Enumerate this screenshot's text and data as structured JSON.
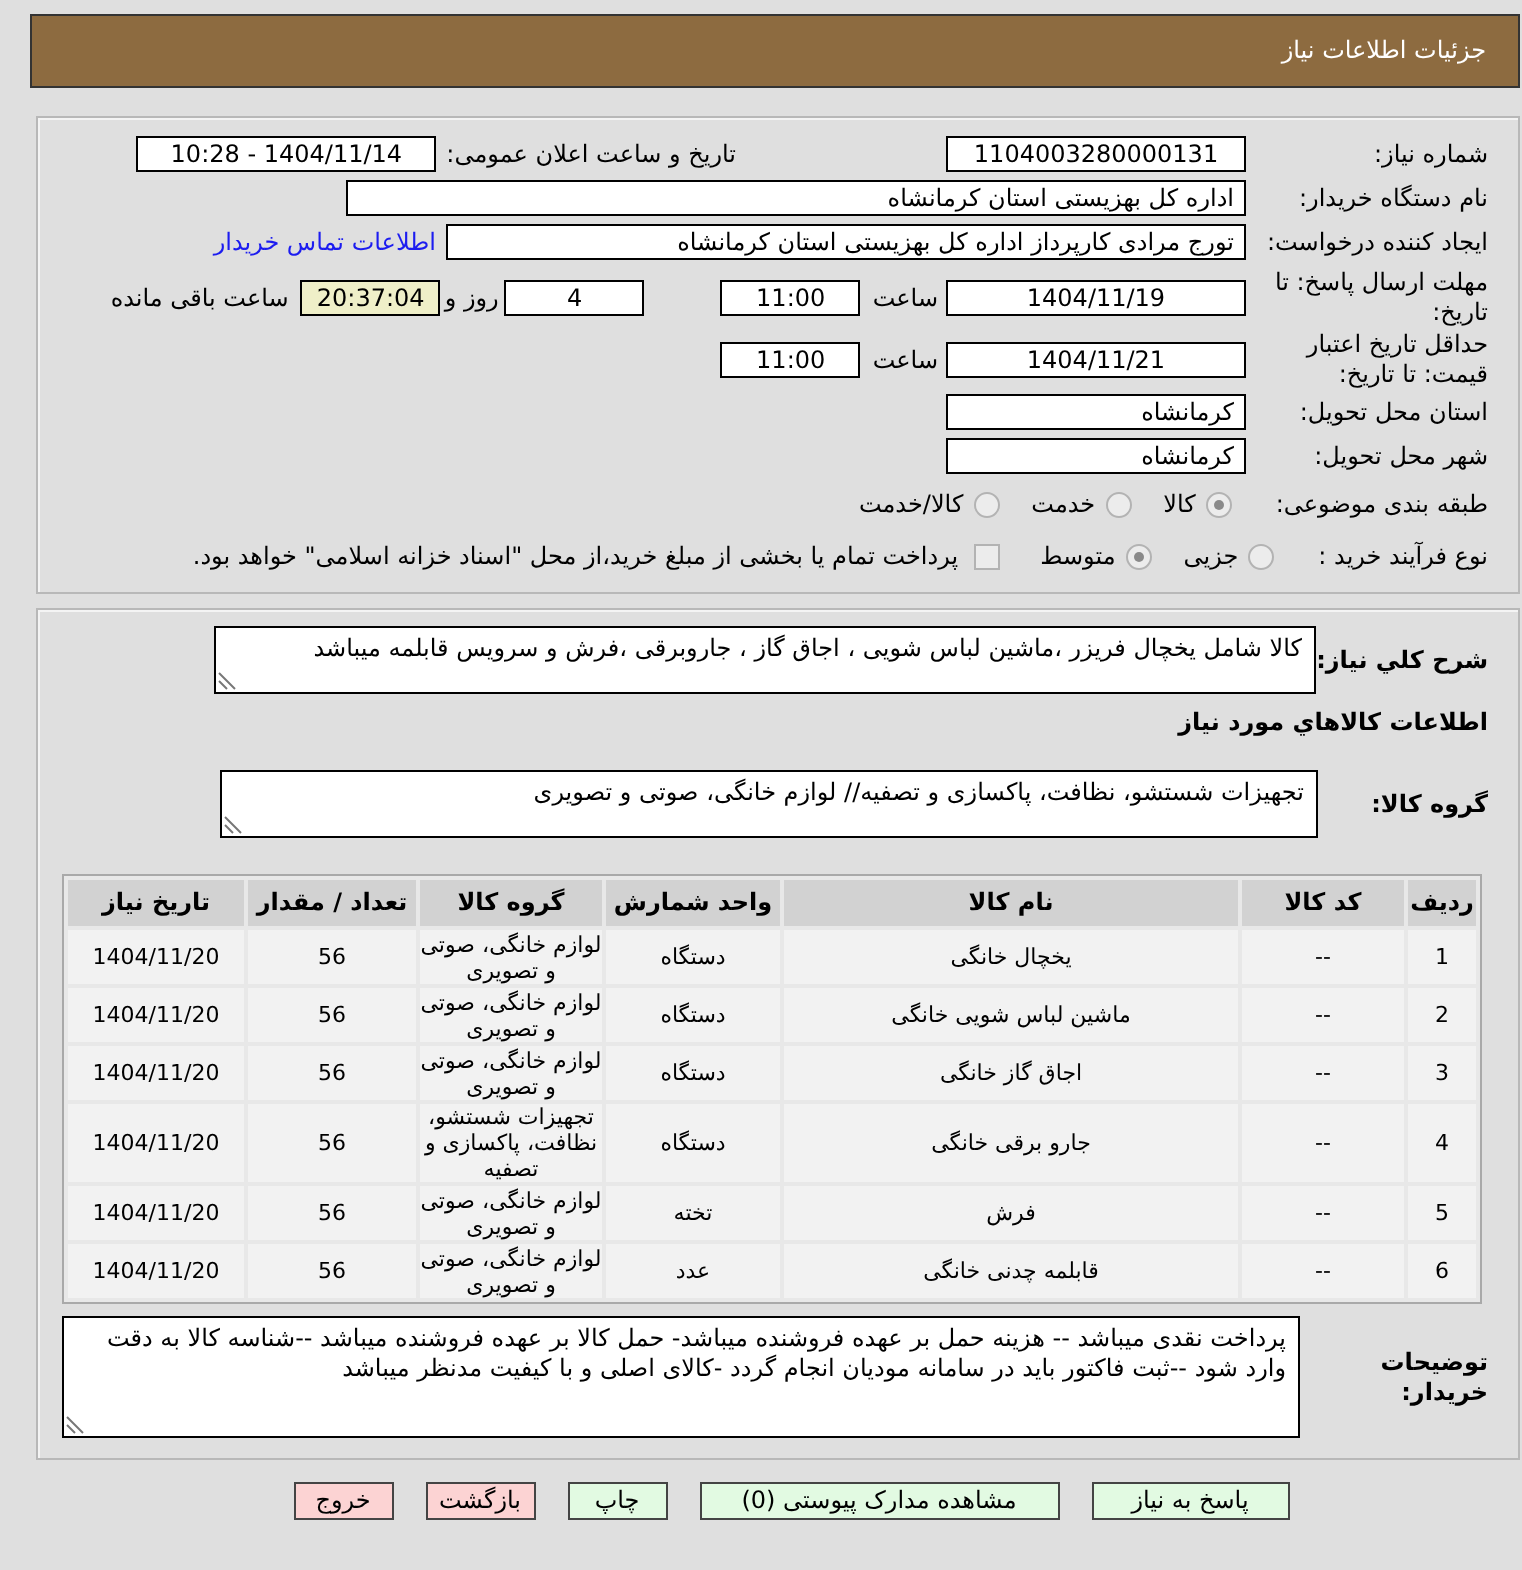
{
  "header": {
    "title": "جزئیات اطلاعات نیاز"
  },
  "details": {
    "need_number": {
      "label": "شماره نیاز:",
      "value": "1104003280000131"
    },
    "announcement": {
      "label": "تاریخ و ساعت اعلان عمومی:",
      "value": "1404/11/14 - 10:28"
    },
    "buyer_org": {
      "label": "نام دستگاه خریدار:",
      "value": "اداره کل بهزیستی استان کرمانشاه"
    },
    "requester": {
      "label": "ایجاد کننده درخواست:",
      "value": "تورج مرادی کارپرداز اداره کل بهزیستی استان کرمانشاه",
      "link": "اطلاعات تماس خریدار"
    },
    "reply_deadline": {
      "label": "مهلت ارسال پاسخ: تا تاریخ:",
      "date": "1404/11/19",
      "time_label": "ساعت",
      "time": "11:00",
      "days": "4",
      "days_label": "روز و",
      "remaining": "20:37:04",
      "remaining_label": "ساعت باقی مانده"
    },
    "price_validity": {
      "label": "حداقل تاریخ اعتبار قیمت: تا تاریخ:",
      "date": "1404/11/21",
      "time_label": "ساعت",
      "time": "11:00"
    },
    "delivery_province": {
      "label": "استان محل تحویل:",
      "value": "کرمانشاه"
    },
    "delivery_city": {
      "label": "شهر محل تحویل:",
      "value": "کرمانشاه"
    },
    "classification": {
      "label": "طبقه بندی موضوعی:",
      "options": [
        {
          "label": "کالا",
          "selected": true,
          "disabled": true
        },
        {
          "label": "خدمت",
          "selected": false,
          "disabled": true
        },
        {
          "label": "کالا/خدمت",
          "selected": false,
          "disabled": true
        }
      ]
    },
    "purchase_type": {
      "label": "نوع فرآیند خرید :",
      "options": [
        {
          "label": "جزیی",
          "selected": false,
          "disabled": true
        },
        {
          "label": "متوسط",
          "selected": true,
          "disabled": true
        }
      ],
      "treasury_option": {
        "label": "پرداخت تمام یا بخشی از مبلغ خرید،از محل \"اسناد خزانه اسلامی\" خواهد بود.",
        "checked": false,
        "disabled": true
      }
    }
  },
  "need_summary": {
    "label": "شرح کلي نیاز:",
    "value": "کالا شامل یخچال فریزر ،ماشین لباس شویی ، اجاق گاز ، جاروبرقی ،فرش و سرویس قابلمه میباشد"
  },
  "goods_heading": "اطلاعات کالاهاي مورد نیاز",
  "goods_group": {
    "label": "گروه کالا:",
    "value": "تجهیزات شستشو، نظافت، پاکسازی و تصفیه// لوازم خانگی، صوتی و تصویری"
  },
  "items_table": {
    "columns": [
      "ردیف",
      "کد کالا",
      "نام کالا",
      "واحد شمارش",
      "گروه کالا",
      "تعداد / مقدار",
      "تاریخ نیاز"
    ],
    "rows": [
      [
        "1",
        "--",
        "یخچال خانگی",
        "دستگاه",
        "لوازم خانگی، صوتی و تصویری",
        "56",
        "1404/11/20"
      ],
      [
        "2",
        "--",
        "ماشین لباس شویی خانگی",
        "دستگاه",
        "لوازم خانگی، صوتی و تصویری",
        "56",
        "1404/11/20"
      ],
      [
        "3",
        "--",
        "اجاق گاز خانگی",
        "دستگاه",
        "لوازم خانگی، صوتی و تصویری",
        "56",
        "1404/11/20"
      ],
      [
        "4",
        "--",
        "جارو برقی خانگی",
        "دستگاه",
        "تجهیزات شستشو، نظافت، پاکسازی و تصفیه",
        "56",
        "1404/11/20"
      ],
      [
        "5",
        "--",
        "فرش",
        "تخته",
        "لوازم خانگی، صوتی و تصویری",
        "56",
        "1404/11/20"
      ],
      [
        "6",
        "--",
        "قابلمه چدنی خانگی",
        "عدد",
        "لوازم خانگی، صوتی و تصویری",
        "56",
        "1404/11/20"
      ]
    ]
  },
  "buyer_notes": {
    "label": "توضیحات خریدار:",
    "value": "پرداخت نقدی میباشد -- هزینه حمل بر عهده فروشنده میباشد- حمل کالا بر عهده فروشنده میباشد --شناسه کالا به دقت وارد شود --ثبت فاکتور باید در سامانه مودیان انجام گردد -کالای اصلی و با کیفیت مدنظر میباشد"
  },
  "buttons": [
    {
      "label": "پاسخ به نیاز",
      "color": "#e2fae2"
    },
    {
      "label": "مشاهده مدارک پیوستی (0)",
      "color": "#e2fae2"
    },
    {
      "label": "چاپ",
      "color": "#e2fae2"
    },
    {
      "label": "بازگشت",
      "color": "#fcd3d3"
    },
    {
      "label": "خروج",
      "color": "#fcd3d3"
    }
  ]
}
